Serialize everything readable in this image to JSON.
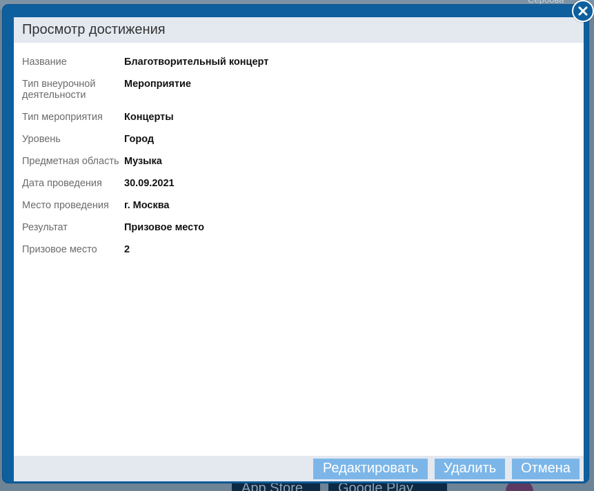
{
  "background": {
    "user_name": "Сербова",
    "store_buttons": [
      "App Store",
      "Google Play"
    ]
  },
  "dialog": {
    "title": "Просмотр достижения",
    "fields": [
      {
        "label": "Название",
        "value": "Благотворительный концерт"
      },
      {
        "label": "Тип внеурочной деятельности",
        "value": "Мероприятие"
      },
      {
        "label": "Тип мероприятия",
        "value": "Концерты"
      },
      {
        "label": "Уровень",
        "value": "Город"
      },
      {
        "label": "Предметная область",
        "value": "Музыка"
      },
      {
        "label": "Дата проведения",
        "value": "30.09.2021"
      },
      {
        "label": "Место проведения",
        "value": "г. Москва"
      },
      {
        "label": "Результат",
        "value": "Призовое место"
      },
      {
        "label": "Призовое место",
        "value": "2"
      }
    ],
    "buttons": {
      "edit": "Редактировать",
      "delete": "Удалить",
      "cancel": "Отмена"
    }
  },
  "colors": {
    "frame": "#0e5f9e",
    "header_bg": "#e4e8ef",
    "button_bg": "#7cb6e8",
    "label_text": "#6b6b6b",
    "value_text": "#111111"
  },
  "icons": {
    "close": "close-icon"
  }
}
